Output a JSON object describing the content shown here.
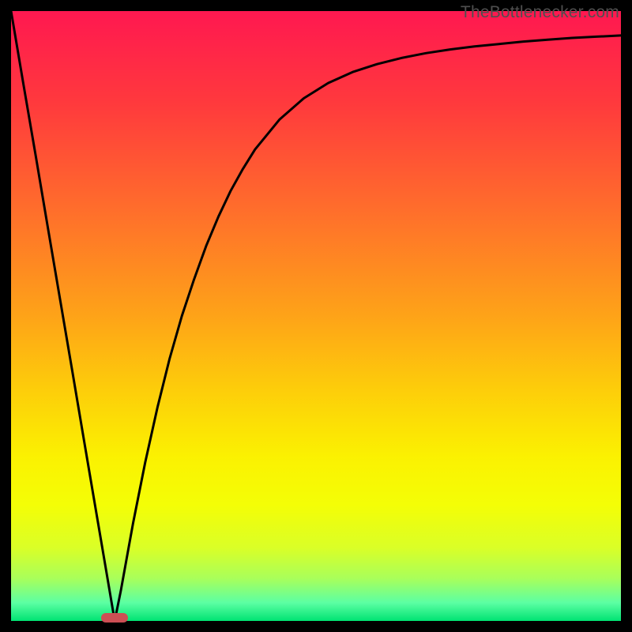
{
  "watermark": "TheBottlenecker.com",
  "chart_data": {
    "type": "line",
    "title": "",
    "xlabel": "",
    "ylabel": "",
    "xlim": [
      0,
      100
    ],
    "ylim": [
      0,
      100
    ],
    "x": [
      0,
      2,
      4,
      6,
      8,
      10,
      12,
      14,
      16,
      17,
      18,
      19,
      20,
      22,
      24,
      26,
      28,
      30,
      32,
      34,
      36,
      38,
      40,
      44,
      48,
      52,
      56,
      60,
      64,
      68,
      72,
      76,
      80,
      84,
      88,
      92,
      96,
      100
    ],
    "values": [
      100,
      88.2,
      76.5,
      64.7,
      52.9,
      41.2,
      29.4,
      17.6,
      5.9,
      0,
      5,
      10.5,
      16,
      26,
      35,
      43,
      50,
      56,
      61.5,
      66.3,
      70.5,
      74.1,
      77.3,
      82.2,
      85.7,
      88.2,
      90.0,
      91.3,
      92.3,
      93.1,
      93.7,
      94.2,
      94.6,
      95.0,
      95.3,
      95.6,
      95.8,
      96.0
    ],
    "gradient_stops": [
      {
        "offset": 0.0,
        "color": "#ff1850"
      },
      {
        "offset": 0.15,
        "color": "#ff393d"
      },
      {
        "offset": 0.33,
        "color": "#ff6f2b"
      },
      {
        "offset": 0.5,
        "color": "#fea318"
      },
      {
        "offset": 0.62,
        "color": "#fdcd0a"
      },
      {
        "offset": 0.73,
        "color": "#fbf101"
      },
      {
        "offset": 0.81,
        "color": "#f4fe06"
      },
      {
        "offset": 0.88,
        "color": "#daff27"
      },
      {
        "offset": 0.93,
        "color": "#a9ff5a"
      },
      {
        "offset": 0.97,
        "color": "#5cffa3"
      },
      {
        "offset": 1.0,
        "color": "#00e373"
      }
    ],
    "sweet_spot": {
      "x": 17,
      "width": 4
    }
  }
}
